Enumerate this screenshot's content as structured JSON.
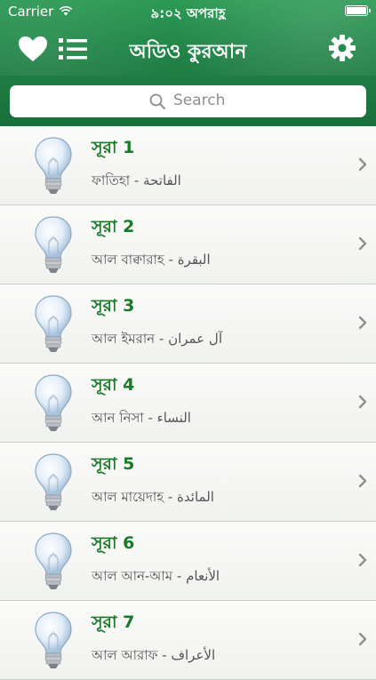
{
  "status_bar": {
    "carrier": "Carrier",
    "time": "৯:০২ অপরাহ্ণ"
  },
  "nav": {
    "title": "অডিও কুরআন",
    "left_icons": [
      "heart-icon",
      "list-icon"
    ],
    "right_icon": "gear-icon"
  },
  "search": {
    "placeholder": "Search"
  },
  "surahs": [
    {
      "title": "সূরা 1",
      "subtitle": "ফাতিহা - الفاتحة"
    },
    {
      "title": "সূরা 2",
      "subtitle": "আল বাক্বারাহ - البقرة"
    },
    {
      "title": "সূরা 3",
      "subtitle": "আল ইমরান - آل عمران"
    },
    {
      "title": "সূরা 4",
      "subtitle": "আন নিসা - النساء"
    },
    {
      "title": "সূরা 5",
      "subtitle": "আল মায়েদাহ - المائدة"
    },
    {
      "title": "সূরা 6",
      "subtitle": "আল আন-আম - الأنعام"
    },
    {
      "title": "সূরা 7",
      "subtitle": "আল আরাফ - الأعراف"
    }
  ],
  "colors": {
    "header_green": "#23884a",
    "title_green": "#1b7a2a"
  }
}
